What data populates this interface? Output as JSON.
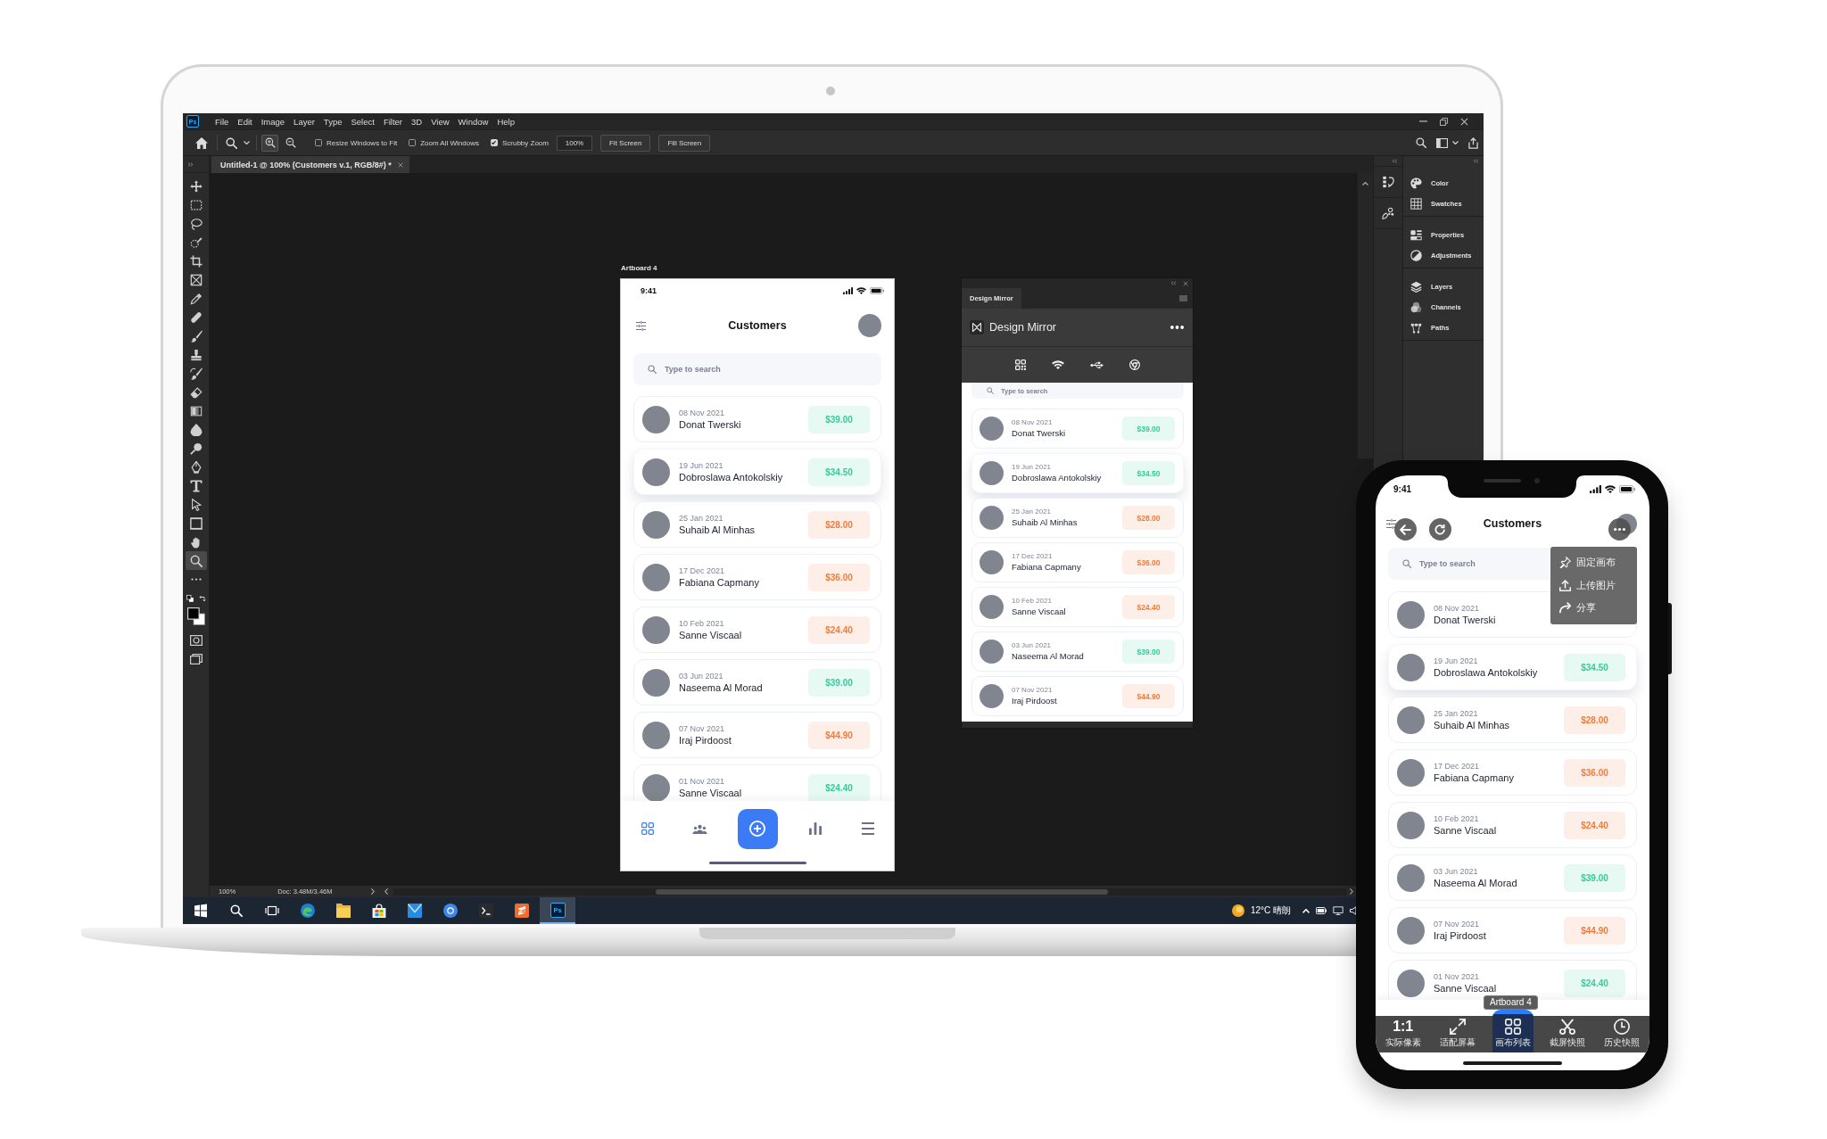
{
  "photoshop": {
    "logo": "Ps",
    "menu": [
      "File",
      "Edit",
      "Image",
      "Layer",
      "Type",
      "Select",
      "Filter",
      "3D",
      "View",
      "Window",
      "Help"
    ],
    "options_bar": {
      "zoom_buttons": [
        {
          "selected": true
        },
        {
          "selected": false
        }
      ],
      "checkboxes": [
        {
          "label": "Resize Windows to Fit",
          "checked": false
        },
        {
          "label": "Zoom All Windows",
          "checked": false
        },
        {
          "label": "Scrubby Zoom",
          "checked": true
        }
      ],
      "zoom_field": "100%",
      "buttons": [
        "Fit Screen",
        "Fill Screen"
      ]
    },
    "document_tab": "Untitled-1 @ 100% (Customers v.1, RGB/8#) *",
    "tools": [
      {
        "selected": false
      },
      {
        "selected": false
      },
      {
        "selected": false
      },
      {
        "selected": false
      },
      {
        "selected": false
      },
      {
        "selected": false
      },
      {
        "selected": false
      },
      {
        "selected": false
      },
      {
        "selected": false
      },
      {
        "selected": false
      },
      {
        "selected": false
      },
      {
        "selected": false
      },
      {
        "selected": false
      },
      {
        "selected": false
      },
      {
        "selected": false
      },
      {
        "selected": false
      },
      {
        "selected": false
      },
      {
        "selected": false
      },
      {
        "selected": false
      },
      {
        "selected": false
      },
      {
        "selected": true
      },
      {
        "selected": false
      }
    ],
    "artboard": {
      "label": "Artboard 4",
      "time": "9:41",
      "title": "Customers",
      "search": {
        "placeholder": "Type to search"
      },
      "customers": [
        {
          "date": "08 Nov 2021",
          "name": "Donat Twerski",
          "amount": "$39.00",
          "color": "#35cc9a",
          "highlighted": false
        },
        {
          "date": "19 Jun 2021",
          "name": "Dobroslawa Antokolskiy",
          "amount": "$34.50",
          "color": "#35cc9a",
          "highlighted": true
        },
        {
          "date": "25 Jan 2021",
          "name": "Suhaib Al Minhas",
          "amount": "$28.00",
          "color": "#f07c3c",
          "highlighted": false
        },
        {
          "date": "17 Dec 2021",
          "name": "Fabiana Capmany",
          "amount": "$36.00",
          "color": "#f07c3c",
          "highlighted": false
        },
        {
          "date": "10 Feb 2021",
          "name": "Sanne Viscaal",
          "amount": "$24.40",
          "color": "#f07c3c",
          "highlighted": false
        },
        {
          "date": "03 Jun 2021",
          "name": "Naseema Al Morad",
          "amount": "$39.00",
          "color": "#35cc9a",
          "highlighted": false
        },
        {
          "date": "07 Nov 2021",
          "name": "Iraj Pirdoost",
          "amount": "$44.90",
          "color": "#f07c3c",
          "highlighted": false
        },
        {
          "date": "01 Nov 2021",
          "name": "Sanne Viscaal",
          "amount": "$24.40",
          "color": "#35cc9a",
          "highlighted": false
        }
      ],
      "nav": [
        {
          "kind": "tab",
          "selected": true
        },
        {
          "kind": "tab",
          "selected": false
        },
        {
          "kind": "add",
          "selected": false
        },
        {
          "kind": "tab",
          "selected": false
        },
        {
          "kind": "tab",
          "selected": false
        }
      ]
    },
    "plugin_panel": {
      "tab": "Design Mirror",
      "title": "Design Mirror",
      "search": {
        "placeholder": "Type to search"
      },
      "customers": [
        {
          "date": "08 Nov 2021",
          "name": "Donat Twerski",
          "amount": "$39.00",
          "color": "#35cc9a",
          "highlighted": false
        },
        {
          "date": "19 Jun 2021",
          "name": "Dobroslawa Antokolskiy",
          "amount": "$34.50",
          "color": "#35cc9a",
          "highlighted": true
        },
        {
          "date": "25 Jan 2021",
          "name": "Suhaib Al Minhas",
          "amount": "$28.00",
          "color": "#f07c3c",
          "highlighted": false
        },
        {
          "date": "17 Dec 2021",
          "name": "Fabiana Capmany",
          "amount": "$36.00",
          "color": "#f07c3c",
          "highlighted": false
        },
        {
          "date": "10 Feb 2021",
          "name": "Sanne Viscaal",
          "amount": "$24.40",
          "color": "#f07c3c",
          "highlighted": false
        },
        {
          "date": "03 Jun 2021",
          "name": "Naseema Al Morad",
          "amount": "$39.00",
          "color": "#35cc9a",
          "highlighted": false
        },
        {
          "date": "07 Nov 2021",
          "name": "Iraj Pirdoost",
          "amount": "$44.90",
          "color": "#f07c3c",
          "highlighted": false
        }
      ]
    },
    "panel_groups": [
      {
        "items": [
          {
            "label": "Color"
          },
          {
            "label": "Swatches"
          }
        ]
      },
      {
        "items": [
          {
            "label": "Properties"
          },
          {
            "label": "Adjustments"
          }
        ]
      },
      {
        "items": [
          {
            "label": "Layers"
          },
          {
            "label": "Channels"
          },
          {
            "label": "Paths"
          }
        ]
      }
    ],
    "status_bar": {
      "zoom": "100%",
      "document_size": "Doc: 3.48M/3.46M"
    }
  },
  "taskbar": {
    "apps": [
      {
        "selected": false
      },
      {
        "selected": false
      },
      {
        "selected": false
      },
      {
        "selected": false
      },
      {
        "selected": false
      },
      {
        "selected": false
      },
      {
        "selected": false
      },
      {
        "selected": false
      },
      {
        "selected": false
      },
      {
        "selected": false
      },
      {
        "selected": true,
        "logo": "Ps"
      }
    ],
    "weather": "12°C 晴朗"
  },
  "phone": {
    "time": "9:41",
    "title": "Customers",
    "search": {
      "placeholder": "Type to search"
    },
    "customers": [
      {
        "date": "08 Nov 2021",
        "name": "Donat Twerski",
        "highlighted": false
      },
      {
        "date": "19 Jun 2021",
        "name": "Dobroslawa Antokolskiy",
        "amount": "$34.50",
        "color": "#35cc9a",
        "highlighted": true
      },
      {
        "date": "25 Jan 2021",
        "name": "Suhaib Al Minhas",
        "amount": "$28.00",
        "color": "#f07c3c",
        "highlighted": false
      },
      {
        "date": "17 Dec 2021",
        "name": "Fabiana Capmany",
        "amount": "$36.00",
        "color": "#f07c3c",
        "highlighted": false
      },
      {
        "date": "10 Feb 2021",
        "name": "Sanne Viscaal",
        "amount": "$24.40",
        "color": "#f07c3c",
        "highlighted": false
      },
      {
        "date": "03 Jun 2021",
        "name": "Naseema Al Morad",
        "amount": "$39.00",
        "color": "#35cc9a",
        "highlighted": false
      },
      {
        "date": "07 Nov 2021",
        "name": "Iraj Pirdoost",
        "amount": "$44.90",
        "color": "#f07c3c",
        "highlighted": false
      },
      {
        "date": "01 Nov 2021",
        "name": "Sanne Viscaal",
        "amount": "$24.40",
        "color": "#35cc9a",
        "highlighted": false
      }
    ],
    "menu": [
      {
        "label": "固定画布"
      },
      {
        "label": "上传图片"
      },
      {
        "label": "分享"
      }
    ],
    "tooltip": "Artboard 4",
    "toolbar": [
      {
        "glyph": "1:1",
        "label": "实际像素",
        "selected": false
      },
      {
        "label": "适配屏幕",
        "selected": false
      },
      {
        "label": "画布列表",
        "selected": true
      },
      {
        "label": "截屏快照",
        "selected": false
      },
      {
        "label": "历史快照",
        "selected": false
      }
    ]
  }
}
